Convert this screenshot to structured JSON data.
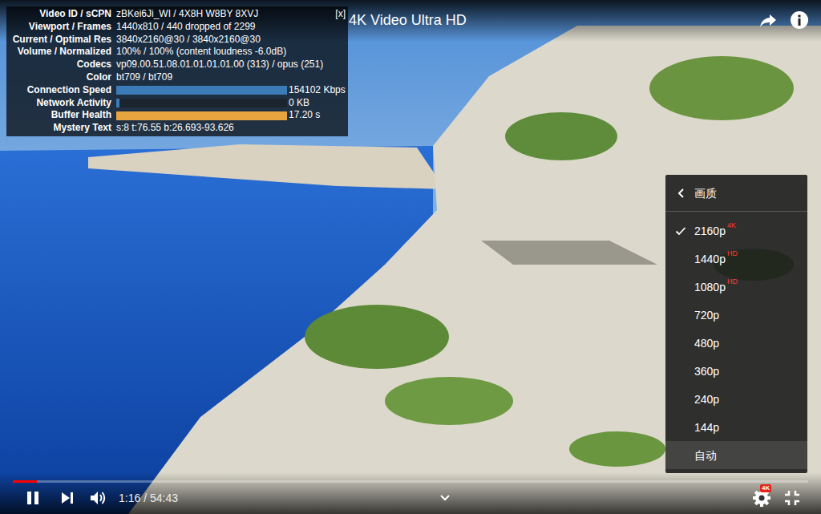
{
  "title": {
    "text": "4K Video Ultra HD"
  },
  "stats": {
    "close": "[x]",
    "rows": [
      {
        "kind": "text",
        "label": "Video ID / sCPN",
        "value": "zBKei6Ji_WI / 4X8H W8BY 8XVJ"
      },
      {
        "kind": "text",
        "label": "Viewport / Frames",
        "value": "1440x810 / 440 dropped of 2299"
      },
      {
        "kind": "text",
        "label": "Current / Optimal Res",
        "value": "3840x2160@30 / 3840x2160@30"
      },
      {
        "kind": "text",
        "label": "Volume / Normalized",
        "value": "100% / 100% (content loudness -6.0dB)"
      },
      {
        "kind": "text",
        "label": "Codecs",
        "value": "vp09.00.51.08.01.01.01.01.00 (313) / opus (251)"
      },
      {
        "kind": "text",
        "label": "Color",
        "value": "bt709 / bt709"
      },
      {
        "kind": "bar",
        "label": "Connection Speed",
        "level": 1,
        "reading": "154102 Kbps",
        "color": "#3b7cb8"
      },
      {
        "kind": "bar",
        "label": "Network Activity",
        "level": 0.02,
        "reading": "0 KB",
        "color": "#3b7cb8"
      },
      {
        "kind": "bar",
        "label": "Buffer Health",
        "level": 1,
        "reading": "17.20 s",
        "color": "#e8a43e"
      },
      {
        "kind": "text",
        "label": "Mystery Text",
        "value": "s:8 t:76.55 b:26.693-93.626"
      }
    ]
  },
  "quality_menu": {
    "title": "画质",
    "items": [
      {
        "label": "2160p",
        "badge": "4K",
        "selected": true,
        "hovered": false
      },
      {
        "label": "1440p",
        "badge": "HD",
        "selected": false,
        "hovered": false
      },
      {
        "label": "1080p",
        "badge": "HD",
        "selected": false,
        "hovered": false
      },
      {
        "label": "720p",
        "selected": false,
        "hovered": false
      },
      {
        "label": "480p",
        "selected": false,
        "hovered": false
      },
      {
        "label": "360p",
        "selected": false,
        "hovered": false
      },
      {
        "label": "240p",
        "selected": false,
        "hovered": false
      },
      {
        "label": "144p",
        "selected": false,
        "hovered": false
      },
      {
        "label": "自动",
        "selected": false,
        "hovered": true
      }
    ]
  },
  "player": {
    "playing": true,
    "progress": {
      "level": 0.03
    },
    "time": "1:16 / 54:43",
    "settings_badge": "4K"
  }
}
